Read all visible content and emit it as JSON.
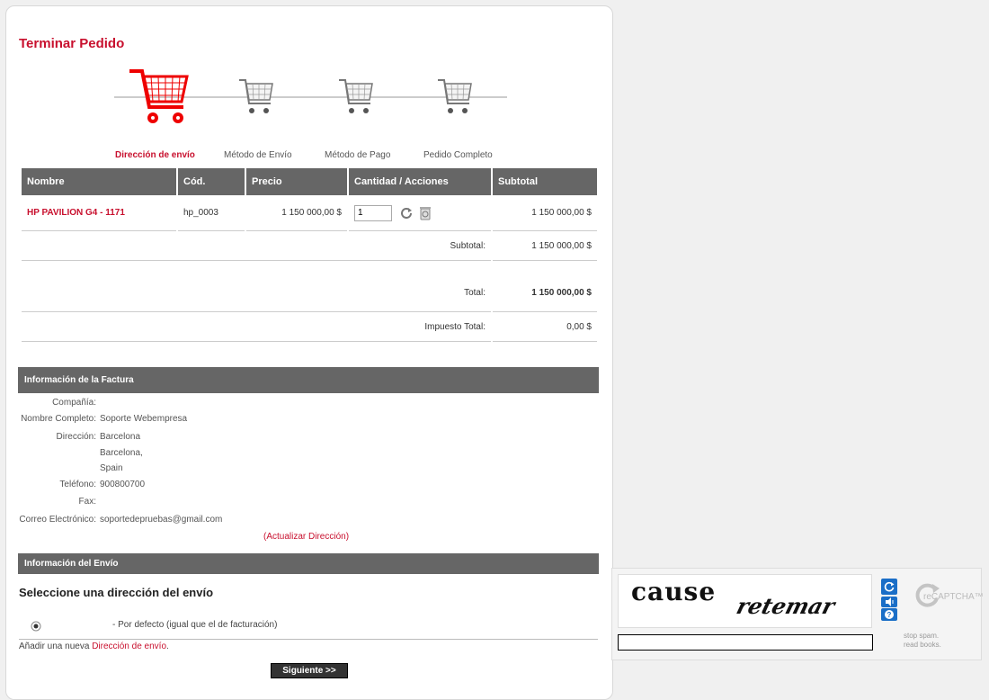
{
  "page": {
    "title": "Terminar Pedido"
  },
  "steps": [
    {
      "label": "Dirección de envío",
      "active": true
    },
    {
      "label": "Método de Envío",
      "active": false
    },
    {
      "label": "Método de Pago",
      "active": false
    },
    {
      "label": "Pedido Completo",
      "active": false
    }
  ],
  "cart": {
    "headers": [
      "Nombre",
      "Cód.",
      "Precio",
      "Cantidad / Acciones",
      "Subtotal"
    ],
    "item": {
      "name": "HP PAVILION G4 - 1171",
      "code": "hp_0003",
      "price": "1 150 000,00 $",
      "quantity": "1",
      "subtotal": "1 150 000,00 $"
    },
    "subtotal_label": "Subtotal:",
    "subtotal_value": "1 150 000,00 $",
    "total_label": "Total:",
    "total_value": "1 150 000,00 $",
    "tax_label": "Impuesto Total:",
    "tax_value": "0,00 $"
  },
  "billing": {
    "header": "Información de la Factura",
    "company_label": "Compañía:",
    "company_value": "",
    "name_label": "Nombre Completo:",
    "name_value": "Soporte Webempresa",
    "address_label": "Dirección:",
    "address_line1": "Barcelona",
    "address_line2": "Barcelona,",
    "address_line3": "Spain",
    "phone_label": "Teléfono:",
    "phone_value": "900800700",
    "fax_label": "Fax:",
    "fax_value": "",
    "email_label": "Correo Electrónico:",
    "email_value": "soportedepruebas@gmail.com",
    "update_link": "(Actualizar Dirección)"
  },
  "shipping": {
    "header": "Información del Envío",
    "heading": "Seleccione una dirección del envío",
    "default_option": "- Por defecto (igual que el de facturación)",
    "add_prefix": "Añadir una nueva",
    "add_link": "Dirección de envío",
    "add_suffix": "."
  },
  "actions": {
    "next_label": "Siguiente >>"
  },
  "captcha": {
    "word1": "cause",
    "word2": "retemar",
    "logo_text": "reCAPTCHA™",
    "tagline1": "stop spam.",
    "tagline2": "read books.",
    "input_value": ""
  },
  "colors": {
    "accent": "#c8102e",
    "header_bg": "#666666",
    "captcha_blue": "#1a6ec7"
  }
}
